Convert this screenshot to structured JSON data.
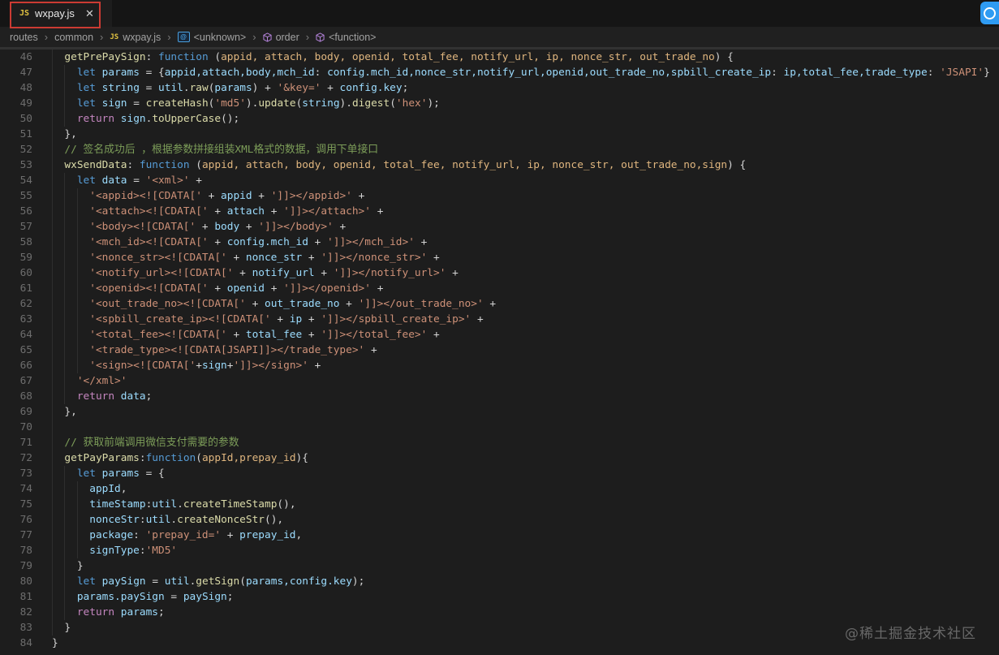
{
  "tab": {
    "file_type_badge": "JS",
    "title": "wxpay.js",
    "close_glyph": "✕"
  },
  "breadcrumbs": {
    "separator": "›",
    "items": [
      {
        "label": "routes",
        "icon": null
      },
      {
        "label": "common",
        "icon": null
      },
      {
        "label": "wxpay.js",
        "icon": "js"
      },
      {
        "label": "<unknown>",
        "icon": "module"
      },
      {
        "label": "order",
        "icon": "method"
      },
      {
        "label": "<function>",
        "icon": "method"
      }
    ]
  },
  "watermark": "@稀土掘金技术社区",
  "theme": {
    "colors": {
      "kw": "#569cd6",
      "ctrl": "#c586c0",
      "fn": "#dcdcaa",
      "var": "#9cdcfe",
      "param": "#e0b67f",
      "str": "#ce9178",
      "op": "#d4d4d4",
      "cm": "#7d9e59",
      "annotation-red": "#cc3b33",
      "badge-yellow": "#e2c341",
      "module-blue": "#4aa0e0",
      "method-purple": "#b180d7",
      "corner-blue": "#2f9bf2"
    }
  },
  "code": {
    "lines": [
      {
        "n": 46,
        "ind": 2,
        "t": [
          [
            "fn",
            "getPrePaySign"
          ],
          [
            "op",
            ": "
          ],
          [
            "kw",
            "function"
          ],
          [
            "op",
            " ("
          ],
          [
            "param",
            "appid, attach, body, openid, total_fee, notify_url, ip, nonce_str, out_trade_no"
          ],
          [
            "op",
            ") {"
          ]
        ]
      },
      {
        "n": 47,
        "ind": 4,
        "t": [
          [
            "kw",
            "let"
          ],
          [
            "op",
            " "
          ],
          [
            "var",
            "params"
          ],
          [
            "op",
            " = {"
          ],
          [
            "var",
            "appid,attach,body,mch_id"
          ],
          [
            "op",
            ": "
          ],
          [
            "var",
            "config.mch_id,nonce_str,notify_url,openid,out_trade_no,spbill_create_ip"
          ],
          [
            "op",
            ": "
          ],
          [
            "var",
            "ip,total_fee,trade_type"
          ],
          [
            "op",
            ": "
          ],
          [
            "str",
            "'JSAPI'"
          ],
          [
            "op",
            "}"
          ]
        ]
      },
      {
        "n": 48,
        "ind": 4,
        "t": [
          [
            "kw",
            "let"
          ],
          [
            "op",
            " "
          ],
          [
            "var",
            "string"
          ],
          [
            "op",
            " = "
          ],
          [
            "var",
            "util"
          ],
          [
            "op",
            "."
          ],
          [
            "fn",
            "raw"
          ],
          [
            "op",
            "("
          ],
          [
            "var",
            "params"
          ],
          [
            "op",
            ") + "
          ],
          [
            "str",
            "'&key='"
          ],
          [
            "op",
            " + "
          ],
          [
            "var",
            "config.key"
          ],
          [
            "op",
            ";"
          ]
        ]
      },
      {
        "n": 49,
        "ind": 4,
        "t": [
          [
            "kw",
            "let"
          ],
          [
            "op",
            " "
          ],
          [
            "var",
            "sign"
          ],
          [
            "op",
            " = "
          ],
          [
            "fn",
            "createHash"
          ],
          [
            "op",
            "("
          ],
          [
            "str",
            "'md5'"
          ],
          [
            "op",
            ")."
          ],
          [
            "fn",
            "update"
          ],
          [
            "op",
            "("
          ],
          [
            "var",
            "string"
          ],
          [
            "op",
            ")."
          ],
          [
            "fn",
            "digest"
          ],
          [
            "op",
            "("
          ],
          [
            "str",
            "'hex'"
          ],
          [
            "op",
            ");"
          ]
        ]
      },
      {
        "n": 50,
        "ind": 4,
        "t": [
          [
            "ctrl",
            "return"
          ],
          [
            "op",
            " "
          ],
          [
            "var",
            "sign"
          ],
          [
            "op",
            "."
          ],
          [
            "fn",
            "toUpperCase"
          ],
          [
            "op",
            "();"
          ]
        ]
      },
      {
        "n": 51,
        "ind": 2,
        "t": [
          [
            "op",
            "},"
          ]
        ]
      },
      {
        "n": 52,
        "ind": 2,
        "t": [
          [
            "cm",
            "// 签名成功后 ，根据参数拼接组装XML格式的数据，调用下单接口"
          ]
        ]
      },
      {
        "n": 53,
        "ind": 2,
        "t": [
          [
            "fn",
            "wxSendData"
          ],
          [
            "op",
            ": "
          ],
          [
            "kw",
            "function"
          ],
          [
            "op",
            " ("
          ],
          [
            "param",
            "appid, attach, body, openid, total_fee, notify_url, ip, nonce_str, out_trade_no,sign"
          ],
          [
            "op",
            ") {"
          ]
        ]
      },
      {
        "n": 54,
        "ind": 4,
        "t": [
          [
            "kw",
            "let"
          ],
          [
            "op",
            " "
          ],
          [
            "var",
            "data"
          ],
          [
            "op",
            " = "
          ],
          [
            "str",
            "'<xml>'"
          ],
          [
            "op",
            " +"
          ]
        ]
      },
      {
        "n": 55,
        "ind": 6,
        "t": [
          [
            "str",
            "'<appid><![CDATA['"
          ],
          [
            "op",
            " + "
          ],
          [
            "var",
            "appid"
          ],
          [
            "op",
            " + "
          ],
          [
            "str",
            "']]></appid>'"
          ],
          [
            "op",
            " +"
          ]
        ]
      },
      {
        "n": 56,
        "ind": 6,
        "t": [
          [
            "str",
            "'<attach><![CDATA['"
          ],
          [
            "op",
            " + "
          ],
          [
            "var",
            "attach"
          ],
          [
            "op",
            " + "
          ],
          [
            "str",
            "']]></attach>'"
          ],
          [
            "op",
            " +"
          ]
        ]
      },
      {
        "n": 57,
        "ind": 6,
        "t": [
          [
            "str",
            "'<body><![CDATA['"
          ],
          [
            "op",
            " + "
          ],
          [
            "var",
            "body"
          ],
          [
            "op",
            " + "
          ],
          [
            "str",
            "']]></body>'"
          ],
          [
            "op",
            " +"
          ]
        ]
      },
      {
        "n": 58,
        "ind": 6,
        "t": [
          [
            "str",
            "'<mch_id><![CDATA['"
          ],
          [
            "op",
            " + "
          ],
          [
            "var",
            "config.mch_id"
          ],
          [
            "op",
            " + "
          ],
          [
            "str",
            "']]></mch_id>'"
          ],
          [
            "op",
            " +"
          ]
        ]
      },
      {
        "n": 59,
        "ind": 6,
        "t": [
          [
            "str",
            "'<nonce_str><![CDATA['"
          ],
          [
            "op",
            " + "
          ],
          [
            "var",
            "nonce_str"
          ],
          [
            "op",
            " + "
          ],
          [
            "str",
            "']]></nonce_str>'"
          ],
          [
            "op",
            " +"
          ]
        ]
      },
      {
        "n": 60,
        "ind": 6,
        "t": [
          [
            "str",
            "'<notify_url><![CDATA['"
          ],
          [
            "op",
            " + "
          ],
          [
            "var",
            "notify_url"
          ],
          [
            "op",
            " + "
          ],
          [
            "str",
            "']]></notify_url>'"
          ],
          [
            "op",
            " +"
          ]
        ]
      },
      {
        "n": 61,
        "ind": 6,
        "t": [
          [
            "str",
            "'<openid><![CDATA['"
          ],
          [
            "op",
            " + "
          ],
          [
            "var",
            "openid"
          ],
          [
            "op",
            " + "
          ],
          [
            "str",
            "']]></openid>'"
          ],
          [
            "op",
            " +"
          ]
        ]
      },
      {
        "n": 62,
        "ind": 6,
        "t": [
          [
            "str",
            "'<out_trade_no><![CDATA['"
          ],
          [
            "op",
            " + "
          ],
          [
            "var",
            "out_trade_no"
          ],
          [
            "op",
            " + "
          ],
          [
            "str",
            "']]></out_trade_no>'"
          ],
          [
            "op",
            " +"
          ]
        ]
      },
      {
        "n": 63,
        "ind": 6,
        "t": [
          [
            "str",
            "'<spbill_create_ip><![CDATA['"
          ],
          [
            "op",
            " + "
          ],
          [
            "var",
            "ip"
          ],
          [
            "op",
            " + "
          ],
          [
            "str",
            "']]></spbill_create_ip>'"
          ],
          [
            "op",
            " +"
          ]
        ]
      },
      {
        "n": 64,
        "ind": 6,
        "t": [
          [
            "str",
            "'<total_fee><![CDATA['"
          ],
          [
            "op",
            " + "
          ],
          [
            "var",
            "total_fee"
          ],
          [
            "op",
            " + "
          ],
          [
            "str",
            "']]></total_fee>'"
          ],
          [
            "op",
            " +"
          ]
        ]
      },
      {
        "n": 65,
        "ind": 6,
        "t": [
          [
            "str",
            "'<trade_type><![CDATA[JSAPI]]></trade_type>'"
          ],
          [
            "op",
            " +"
          ]
        ]
      },
      {
        "n": 66,
        "ind": 6,
        "t": [
          [
            "str",
            "'<sign><![CDATA['"
          ],
          [
            "op",
            "+"
          ],
          [
            "var",
            "sign"
          ],
          [
            "op",
            "+"
          ],
          [
            "str",
            "']]></sign>'"
          ],
          [
            "op",
            " +"
          ]
        ]
      },
      {
        "n": 67,
        "ind": 4,
        "t": [
          [
            "str",
            "'</xml>'"
          ]
        ]
      },
      {
        "n": 68,
        "ind": 4,
        "t": [
          [
            "ctrl",
            "return"
          ],
          [
            "op",
            " "
          ],
          [
            "var",
            "data"
          ],
          [
            "op",
            ";"
          ]
        ]
      },
      {
        "n": 69,
        "ind": 2,
        "t": [
          [
            "op",
            "},"
          ]
        ]
      },
      {
        "n": 70,
        "ind": 2,
        "t": []
      },
      {
        "n": 71,
        "ind": 2,
        "t": [
          [
            "cm",
            "// 获取前端调用微信支付需要的参数"
          ]
        ]
      },
      {
        "n": 72,
        "ind": 2,
        "t": [
          [
            "fn",
            "getPayParams"
          ],
          [
            "op",
            ":"
          ],
          [
            "kw",
            "function"
          ],
          [
            "op",
            "("
          ],
          [
            "param",
            "appId,prepay_id"
          ],
          [
            "op",
            "){"
          ]
        ]
      },
      {
        "n": 73,
        "ind": 4,
        "t": [
          [
            "kw",
            "let"
          ],
          [
            "op",
            " "
          ],
          [
            "var",
            "params"
          ],
          [
            "op",
            " = {"
          ]
        ]
      },
      {
        "n": 74,
        "ind": 6,
        "t": [
          [
            "var",
            "appId"
          ],
          [
            "op",
            ","
          ]
        ]
      },
      {
        "n": 75,
        "ind": 6,
        "t": [
          [
            "var",
            "timeStamp"
          ],
          [
            "op",
            ":"
          ],
          [
            "var",
            "util"
          ],
          [
            "op",
            "."
          ],
          [
            "fn",
            "createTimeStamp"
          ],
          [
            "op",
            "(),"
          ]
        ]
      },
      {
        "n": 76,
        "ind": 6,
        "t": [
          [
            "var",
            "nonceStr"
          ],
          [
            "op",
            ":"
          ],
          [
            "var",
            "util"
          ],
          [
            "op",
            "."
          ],
          [
            "fn",
            "createNonceStr"
          ],
          [
            "op",
            "(),"
          ]
        ]
      },
      {
        "n": 77,
        "ind": 6,
        "t": [
          [
            "var",
            "package"
          ],
          [
            "op",
            ": "
          ],
          [
            "str",
            "'prepay_id='"
          ],
          [
            "op",
            " + "
          ],
          [
            "var",
            "prepay_id"
          ],
          [
            "op",
            ","
          ]
        ]
      },
      {
        "n": 78,
        "ind": 6,
        "t": [
          [
            "var",
            "signType"
          ],
          [
            "op",
            ":"
          ],
          [
            "str",
            "'MD5'"
          ]
        ]
      },
      {
        "n": 79,
        "ind": 4,
        "t": [
          [
            "op",
            "}"
          ]
        ]
      },
      {
        "n": 80,
        "ind": 4,
        "t": [
          [
            "kw",
            "let"
          ],
          [
            "op",
            " "
          ],
          [
            "var",
            "paySign"
          ],
          [
            "op",
            " = "
          ],
          [
            "var",
            "util"
          ],
          [
            "op",
            "."
          ],
          [
            "fn",
            "getSign"
          ],
          [
            "op",
            "("
          ],
          [
            "var",
            "params,config.key"
          ],
          [
            "op",
            ");"
          ]
        ]
      },
      {
        "n": 81,
        "ind": 4,
        "t": [
          [
            "var",
            "params.paySign"
          ],
          [
            "op",
            " = "
          ],
          [
            "var",
            "paySign"
          ],
          [
            "op",
            ";"
          ]
        ]
      },
      {
        "n": 82,
        "ind": 4,
        "t": [
          [
            "ctrl",
            "return"
          ],
          [
            "op",
            " "
          ],
          [
            "var",
            "params"
          ],
          [
            "op",
            ";"
          ]
        ]
      },
      {
        "n": 83,
        "ind": 2,
        "t": [
          [
            "op",
            "}"
          ]
        ]
      },
      {
        "n": 84,
        "ind": 0,
        "t": [
          [
            "op",
            "}"
          ]
        ]
      }
    ]
  }
}
